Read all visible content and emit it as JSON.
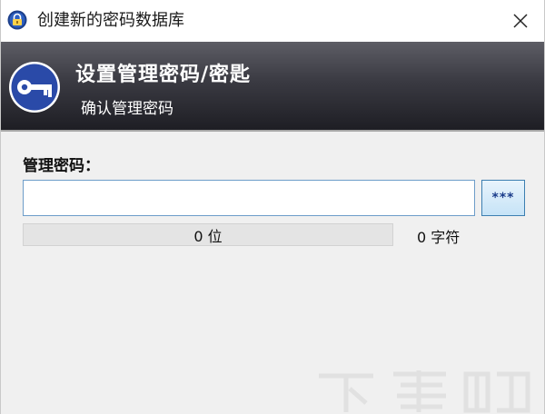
{
  "window": {
    "title": "创建新的密码数据库",
    "app_icon": "padlock-icon",
    "close_icon": "close-icon"
  },
  "banner": {
    "title": "设置管理密码/密匙",
    "subtitle": "确认管理密码",
    "icon": "key-icon"
  },
  "form": {
    "password_label": "管理密码：",
    "password_value": "",
    "mask_toggle_label": "***",
    "strength_text": "0 位",
    "strength_fraction": 0,
    "char_count": "0 字符"
  },
  "colors": {
    "banner_top": "#5d5d65",
    "banner_bottom": "#1e1e24",
    "key_circle": "#2a4aa8",
    "input_border": "#6d9dc9",
    "toggle_border": "#3c7fb1"
  }
}
